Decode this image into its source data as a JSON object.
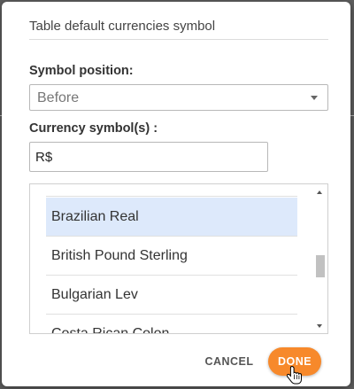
{
  "dialog": {
    "title": "Table default currencies symbol",
    "symbol_position_label": "Symbol position:",
    "symbol_position_value": "Before",
    "currency_symbol_label": "Currency symbol(s) :",
    "currency_symbol_value": "R$"
  },
  "currency_list": {
    "items": [
      {
        "label": "",
        "selected": false
      },
      {
        "label": "Brazilian Real",
        "selected": true
      },
      {
        "label": "British Pound Sterling",
        "selected": false
      },
      {
        "label": "Bulgarian Lev",
        "selected": false
      },
      {
        "label": "Costa Rican Colon",
        "selected": false
      }
    ]
  },
  "buttons": {
    "cancel_label": "CANCEL",
    "done_label": "DONE"
  },
  "colors": {
    "accent": "#f7892b",
    "selected_row": "#dde9fb"
  },
  "icons": {
    "select_caret": "caret-down-icon",
    "scroll_up": "arrow-up-icon",
    "scroll_down": "arrow-down-icon",
    "cursor": "hand-pointer-icon"
  }
}
